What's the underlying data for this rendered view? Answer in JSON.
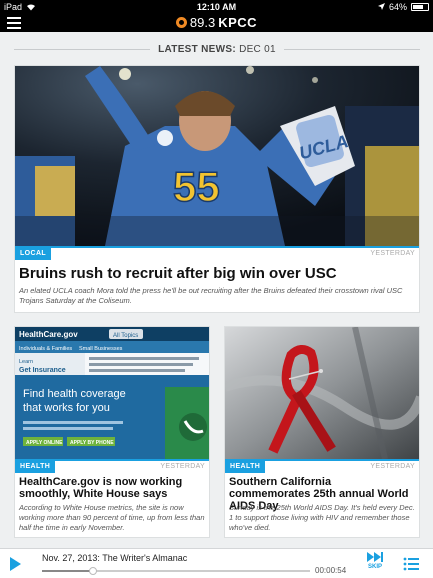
{
  "status_bar": {
    "device": "iPad",
    "time": "12:10 AM",
    "battery": "64%",
    "battery_level": 0.64
  },
  "app": {
    "logo_frequency": "89.3",
    "logo_callsign": "KPCC"
  },
  "latest": {
    "label": "LATEST NEWS:",
    "date": "DEC 01"
  },
  "stories": {
    "main": {
      "tag": "LOCAL",
      "when": "YESTERDAY",
      "headline": "Bruins rush to recruit after big win over USC",
      "dek": "An elated UCLA coach Mora told the press he'll be out recruiting after the Bruins defeated their crosstown rival USC Trojans Saturday at the Coliseum."
    },
    "left": {
      "tag": "HEALTH",
      "when": "YESTERDAY",
      "headline": "HealthCare.gov is now working smoothly, White House says",
      "dek": "According to White House metrics, the site is now working more than 90 percent of time, up from less than half the time in early November."
    },
    "right": {
      "tag": "HEALTH",
      "when": "YESTERDAY",
      "headline": "Southern California commemorates 25th annual World AIDS Day",
      "dek": "Sunday is the 25th World AIDS Day. It's held every Dec. 1 to support those living with HIV and remember those who've died."
    }
  },
  "image_text": {
    "jersey_number": "55",
    "ucla": "UCLA",
    "hc_brand": "HealthCare.gov",
    "hc_tab": "All Topics",
    "hc_nav1": "Individuals & Families",
    "hc_nav2": "Small Businesses",
    "hc_learn": "Learn",
    "hc_get": "Get Insurance",
    "hc_find": "Find health coverage",
    "hc_that": "that works for you",
    "hc_apply_online": "APPLY ONLINE",
    "hc_apply_phone": "APPLY BY PHONE"
  },
  "player": {
    "title": "Nov. 27, 2013: The Writer's Almanac",
    "time": "00:00:54",
    "skip_label": "SKIP",
    "progress": 0.19
  },
  "colors": {
    "accent": "#1aa0e0",
    "logo_orange": "#f08a24",
    "ribbon_red": "#c4161c"
  }
}
